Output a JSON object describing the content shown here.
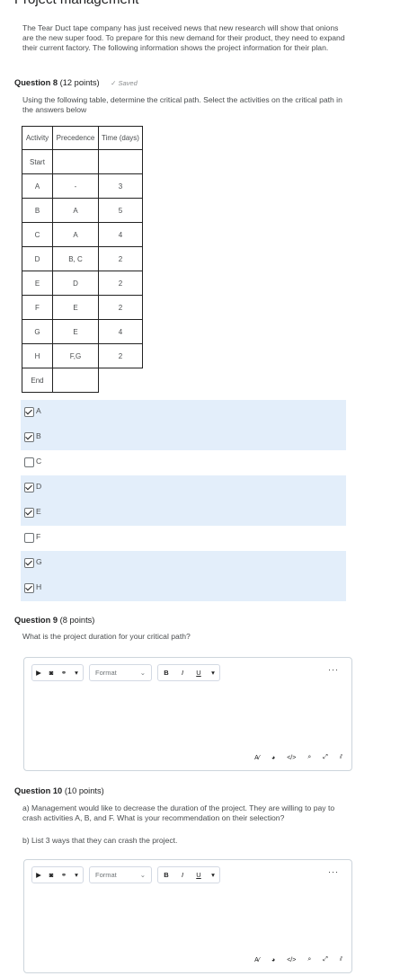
{
  "page": {
    "title": "Project management",
    "intro": "The Tear Duct tape company has just received news that new research will show that onions are the new super food. To prepare for this new demand for their product, they need to expand their current factory. The following information shows the project information for their plan."
  },
  "q8": {
    "label": "Question 8",
    "points": "(12 points)",
    "saved": "Saved",
    "text": "Using the following table, determine the critical path.  Select the activities on the critical path in the answers below",
    "table": {
      "headers": [
        "Activity",
        "Precedence",
        "Time (days)"
      ],
      "rows": [
        [
          "Start",
          "",
          ""
        ],
        [
          "A",
          "-",
          "3"
        ],
        [
          "B",
          "A",
          "5"
        ],
        [
          "C",
          "A",
          "4"
        ],
        [
          "D",
          "B, C",
          "2"
        ],
        [
          "E",
          "D",
          "2"
        ],
        [
          "F",
          "E",
          "2"
        ],
        [
          "G",
          "E",
          "4"
        ],
        [
          "H",
          "F,G",
          "2"
        ],
        [
          "End",
          "",
          ""
        ]
      ]
    },
    "options": [
      {
        "label": "A",
        "checked": true
      },
      {
        "label": "B",
        "checked": true
      },
      {
        "label": "C",
        "checked": false
      },
      {
        "label": "D",
        "checked": true
      },
      {
        "label": "E",
        "checked": true
      },
      {
        "label": "F",
        "checked": false
      },
      {
        "label": "G",
        "checked": true
      },
      {
        "label": "H",
        "checked": true
      }
    ]
  },
  "q9": {
    "label": "Question 9",
    "points": "(8 points)",
    "text": "What is the project duration for your critical path?",
    "format_label": "Format"
  },
  "q10": {
    "label": "Question 10",
    "points": "(10 points)",
    "text_a": "a) Management would like to decrease the duration of the project.  They are willing to pay to crash activities A, B, and F.  What is your recommendation on their selection?",
    "text_b": "b) List 3 ways that they can crash the project.",
    "format_label": "Format"
  },
  "toolbar": {
    "bold": "B",
    "italic": "I",
    "underline": "U",
    "more": "···"
  },
  "colors": {
    "highlight": "#e3eefa",
    "border": "#cdd5dc",
    "text": "#494c4e"
  }
}
